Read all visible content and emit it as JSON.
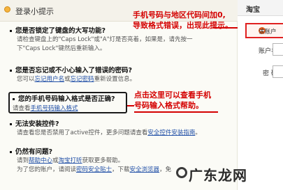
{
  "tips": {
    "title": "登录小提示",
    "sections": [
      {
        "question": "您是否锁定了键盘的大写功能?",
        "lines": [
          "请检查键盘上的\"Caps Lock\"或\"A\"灯是否亮着，如果是，请先按一",
          "下\"Caps Lock\"键然后重新输入。"
        ]
      },
      {
        "question": "您是否忘记或不小心输入了错误的密码?",
        "line_prefix": "您可以",
        "link1": "忘记用户名",
        "line_mid": "或",
        "link2": "忘记密码",
        "line_suffix": "重新设置信息。"
      },
      {
        "question": "您的手机号码输入格式是否正确?",
        "line_prefix": "请查看",
        "link": "手机号码输入格式",
        "line_suffix": "。"
      },
      {
        "question": "无法安装控件?",
        "line_prefix": "请查看您是否禁用了active控件，更多问题请查看",
        "link": "安全控件安装指南",
        "line_suffix": "。"
      },
      {
        "question": "仍然有问题?",
        "line1_prefix": "请到",
        "line1_link": "帮助中心",
        "line1_mid": "或",
        "line1_link2": "淘宝打听",
        "line1_suffix": "获取更多帮助。",
        "line2_prefix": "为了您的账户，请阅读",
        "line2_link": "密码安全贴士",
        "line2_mid": "，下载",
        "line2_link2": "安全浏览器",
        "line2_suffix": "，免"
      }
    ]
  },
  "annotations": {
    "top_note_line1": "手机号码与地区代码间加0,",
    "top_note_line2": "导致格式错误，出现此提示。",
    "mid_note_line1": "点击这里可以查看手机",
    "mid_note_line2": "号码输入格式帮助。"
  },
  "login": {
    "header": "淘宝",
    "error_text": "该账户",
    "username_label": "账户名",
    "password_label": "密  码"
  },
  "watermark": "广东龙网",
  "colors": {
    "annotation": "#d40000",
    "link": "#1f4ea6",
    "error_border": "#e02020"
  }
}
